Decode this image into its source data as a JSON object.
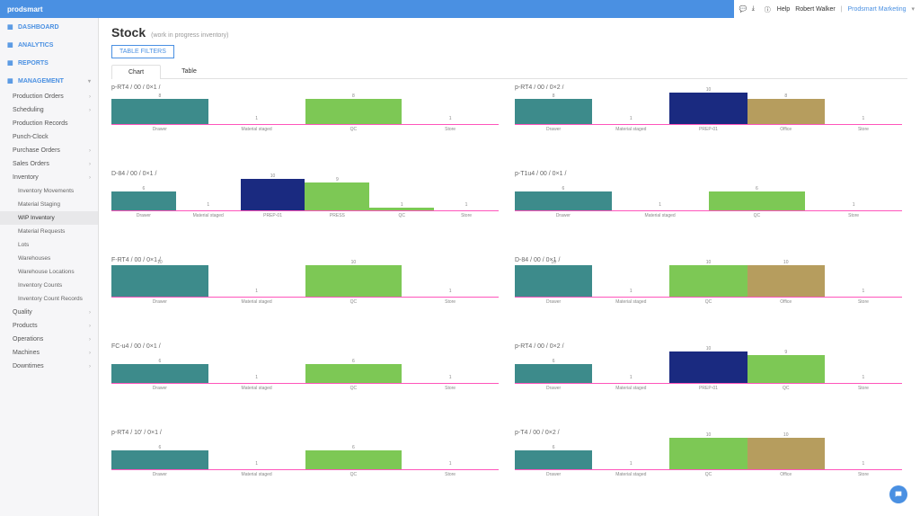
{
  "header": {
    "brand": "prodsmart",
    "help": "Help",
    "user": "Robert Walker",
    "company": "Prodsmart Marketing"
  },
  "sidebar": {
    "top": [
      {
        "label": "DASHBOARD",
        "icon": "gauge"
      },
      {
        "label": "ANALYTICS",
        "icon": "bars"
      },
      {
        "label": "REPORTS",
        "icon": "doc"
      },
      {
        "label": "MANAGEMENT",
        "icon": "grid",
        "active": true
      }
    ],
    "items": [
      {
        "label": "Production Orders",
        "expand": true
      },
      {
        "label": "Scheduling",
        "expand": true
      },
      {
        "label": "Production Records"
      },
      {
        "label": "Punch-Clock"
      },
      {
        "label": "Purchase Orders",
        "expand": true
      },
      {
        "label": "Sales Orders",
        "expand": true
      },
      {
        "label": "Inventory",
        "expand": true,
        "open": true
      },
      {
        "label": "Inventory Movements",
        "sub": true
      },
      {
        "label": "Material Staging",
        "sub": true
      },
      {
        "label": "WIP Inventory",
        "sub": true,
        "active": true
      },
      {
        "label": "Material Requests",
        "sub": true
      },
      {
        "label": "Lots",
        "sub": true
      },
      {
        "label": "Warehouses",
        "sub": true
      },
      {
        "label": "Warehouse Locations",
        "sub": true
      },
      {
        "label": "Inventory Counts",
        "sub": true
      },
      {
        "label": "Inventory Count Records",
        "sub": true
      },
      {
        "label": "Quality",
        "expand": true
      },
      {
        "label": "Products",
        "expand": true
      },
      {
        "label": "Operations",
        "expand": true
      },
      {
        "label": "Machines",
        "expand": true
      },
      {
        "label": "Downtimes",
        "expand": true
      }
    ]
  },
  "page": {
    "title": "Stock",
    "subtitle": "(work in progress inventory)",
    "filters_btn": "TABLE FILTERS",
    "tabs": [
      "Chart",
      "Table"
    ],
    "active_tab": 0
  },
  "colors": {
    "Drawer": "#3d8b8b",
    "Material staged": "#ffffff",
    "PREP-01": "#1a2a80",
    "PRESS": "#7dc855",
    "QC": "#7dc855",
    "Store": "#ffffff",
    "Office": "#b69d5e"
  },
  "chart_data": [
    {
      "title": "p-RT4 / 00 / 0×1 /",
      "type": "bar",
      "categories": [
        "Drawer",
        "Material staged",
        "QC",
        "Store"
      ],
      "values": [
        8,
        1,
        8,
        1
      ],
      "colors": [
        "#3d8b8b",
        "#ffffff",
        "#7dc855",
        "#ffffff"
      ],
      "ylim": [
        0,
        10
      ]
    },
    {
      "title": "p-RT4 / 00 / 0×2 /",
      "type": "bar",
      "categories": [
        "Drawer",
        "Material staged",
        "PREP-01",
        "Office",
        "Store"
      ],
      "values": [
        8,
        1,
        10,
        8,
        1
      ],
      "colors": [
        "#3d8b8b",
        "#ffffff",
        "#1a2a80",
        "#b69d5e",
        "#ffffff"
      ],
      "ylim": [
        0,
        10
      ]
    },
    {
      "title": "D-84 / 00 / 0×1 /",
      "type": "bar",
      "categories": [
        "Drawer",
        "Material staged",
        "PREP-01",
        "PRESS",
        "QC",
        "Store"
      ],
      "values": [
        6,
        1,
        10,
        9,
        1,
        1
      ],
      "colors": [
        "#3d8b8b",
        "#ffffff",
        "#1a2a80",
        "#7dc855",
        "#7dc855",
        "#ffffff"
      ],
      "ylim": [
        0,
        10
      ]
    },
    {
      "title": "p-T1u4 / 00 / 0×1 /",
      "type": "bar",
      "categories": [
        "Drawer",
        "Material staged",
        "QC",
        "Store"
      ],
      "values": [
        6,
        1,
        6,
        1
      ],
      "colors": [
        "#3d8b8b",
        "#ffffff",
        "#7dc855",
        "#ffffff"
      ],
      "ylim": [
        0,
        10
      ]
    },
    {
      "title": "F-RT4 / 00 / 0×1 /",
      "type": "bar",
      "categories": [
        "Drawer",
        "Material staged",
        "QC",
        "Store"
      ],
      "values": [
        10,
        1,
        10,
        1
      ],
      "colors": [
        "#3d8b8b",
        "#ffffff",
        "#7dc855",
        "#ffffff"
      ],
      "ylim": [
        0,
        10
      ]
    },
    {
      "title": "D-84 / 00 / 0×1 /",
      "type": "bar",
      "categories": [
        "Drawer",
        "Material staged",
        "QC",
        "Office",
        "Store"
      ],
      "values": [
        10,
        1,
        10,
        10,
        1
      ],
      "colors": [
        "#3d8b8b",
        "#ffffff",
        "#7dc855",
        "#b69d5e",
        "#ffffff"
      ],
      "ylim": [
        0,
        10
      ]
    },
    {
      "title": "FC-u4 / 00 / 0×1 /",
      "type": "bar",
      "categories": [
        "Drawer",
        "Material staged",
        "QC",
        "Store"
      ],
      "values": [
        6,
        1,
        6,
        1
      ],
      "colors": [
        "#3d8b8b",
        "#ffffff",
        "#7dc855",
        "#ffffff"
      ],
      "ylim": [
        0,
        10
      ]
    },
    {
      "title": "p-RT4 / 00 / 0×2 /",
      "type": "bar",
      "categories": [
        "Drawer",
        "Material staged",
        "PREP-01",
        "QC",
        "Store"
      ],
      "values": [
        6,
        1,
        10,
        9,
        1
      ],
      "colors": [
        "#3d8b8b",
        "#ffffff",
        "#1a2a80",
        "#7dc855",
        "#ffffff"
      ],
      "ylim": [
        0,
        10
      ]
    },
    {
      "title": "p-RT4 / 10' / 0×1 /",
      "type": "bar",
      "categories": [
        "Drawer",
        "Material staged",
        "QC",
        "Store"
      ],
      "values": [
        6,
        1,
        6,
        1
      ],
      "colors": [
        "#3d8b8b",
        "#ffffff",
        "#7dc855",
        "#ffffff"
      ],
      "ylim": [
        0,
        10
      ]
    },
    {
      "title": "p-T4 / 00 / 0×2 /",
      "type": "bar",
      "categories": [
        "Drawer",
        "Material staged",
        "QC",
        "Office",
        "Store"
      ],
      "values": [
        6,
        1,
        10,
        10,
        1
      ],
      "colors": [
        "#3d8b8b",
        "#ffffff",
        "#7dc855",
        "#b69d5e",
        "#ffffff"
      ],
      "ylim": [
        0,
        10
      ]
    }
  ]
}
